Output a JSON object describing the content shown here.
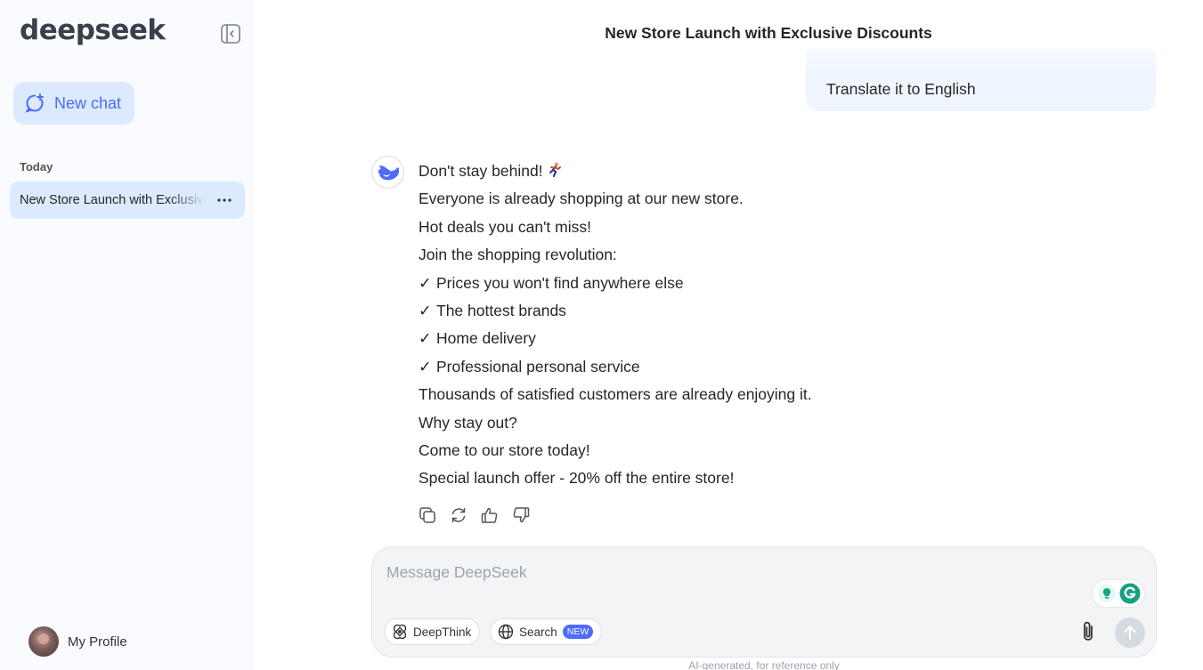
{
  "sidebar": {
    "logo": "deepseek",
    "new_chat_label": "New chat",
    "section_today": "Today",
    "chats": [
      {
        "label": "New Store Launch with Exclusive Discounts"
      }
    ],
    "profile_label": "My Profile"
  },
  "chat": {
    "title": "New Store Launch with Exclusive Discounts",
    "user_message": "Translate it to English",
    "answer_lines": [
      "Don't stay behind!",
      "Everyone is already shopping at our new store.",
      "Hot deals you can't miss!",
      "Join the shopping revolution:",
      "Prices you won't find anywhere else",
      "The hottest brands",
      "Home delivery",
      "Professional personal service",
      "Thousands of satisfied customers are already enjoying it.",
      "Why stay out?",
      "Come to our store today!",
      "Special launch offer - 20% off the entire store!"
    ],
    "check_glyph": "✓"
  },
  "composer": {
    "placeholder": "Message DeepSeek",
    "deepthink_label": "DeepThink",
    "search_label": "Search",
    "search_badge": "NEW",
    "disclaimer": "AI-generated, for reference only"
  },
  "colors": {
    "accent": "#4d6bfe",
    "sidebar_bg": "#f9fbff",
    "selected_bg": "#dbeafe",
    "user_bubble_bg": "#eff6ff"
  }
}
